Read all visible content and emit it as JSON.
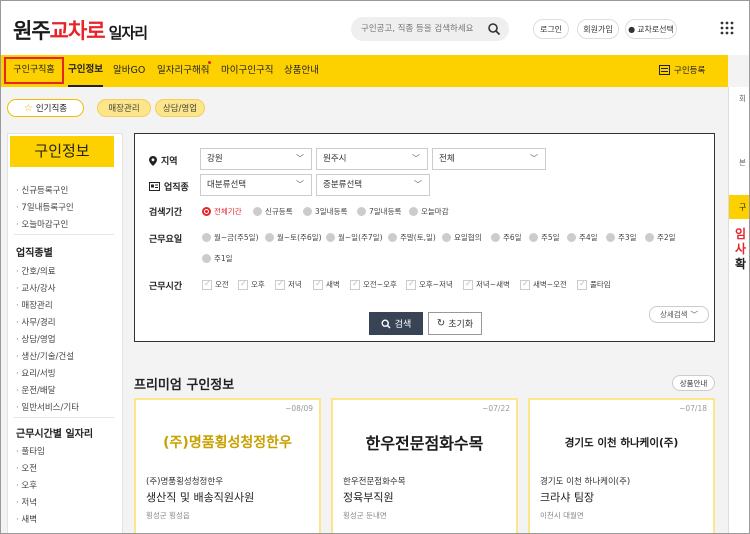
{
  "header": {
    "logo_part1": "원주",
    "logo_part2": "교차로",
    "logo_part3": "일자리",
    "search_placeholder": "구인공고, 직종 등을 검색하세요",
    "login": "로그인",
    "signup": "회원가입",
    "region_select": "교차로선택"
  },
  "nav": {
    "items": [
      {
        "label": "구인구직홈"
      },
      {
        "label": "구인정보"
      },
      {
        "label": "알바GO"
      },
      {
        "label": "일자리구해줘"
      },
      {
        "label": "마이구인구직"
      },
      {
        "label": "상품안내"
      }
    ],
    "register": "구인등록"
  },
  "chips": {
    "popular": "인기직종",
    "items": [
      "매장관리",
      "상담/영업"
    ]
  },
  "sidebar": {
    "title": "구인정보",
    "group1": [
      "신규등록구인",
      "7일내등록구인",
      "오늘마감구인"
    ],
    "head2": "업직종별",
    "group2": [
      "간호/의료",
      "교사/강사",
      "매장관리",
      "사무/경리",
      "상담/영업",
      "생산/기술/건설",
      "요리/서빙",
      "운전/배달",
      "일반서비스/기타"
    ],
    "head3": "근무시간별 일자리",
    "group3": [
      "풀타임",
      "오전",
      "오후",
      "저녁",
      "새벽"
    ]
  },
  "filter": {
    "region_label": "지역",
    "region_values": [
      "강원",
      "원주시",
      "전체"
    ],
    "industry_label": "업직종",
    "industry_values": [
      "대분류선택",
      "중분류선택"
    ],
    "period_label": "검색기간",
    "period_options": [
      "전체기간",
      "신규등록",
      "3일내등록",
      "7일내등록",
      "오늘마감"
    ],
    "period_selected": "전체기간",
    "days_label": "근무요일",
    "days_options": [
      "월~금(주5일)",
      "월~토(주6일)",
      "월~일(주7일)",
      "주말(토,일)",
      "요일협의",
      "주6일",
      "주5일",
      "주4일",
      "주3일",
      "주2일",
      "주1일"
    ],
    "hours_label": "근무시간",
    "hours_options": [
      "오전",
      "오후",
      "저녁",
      "새벽",
      "오전~오후",
      "오후~저녁",
      "저녁~새벽",
      "새벽~오전",
      "풀타임"
    ],
    "search_btn": "검색",
    "reset_btn": "초기화",
    "detail_btn": "상세검색"
  },
  "premium": {
    "title": "프리미엄 구인정보",
    "guide_btn": "상품안내",
    "cards": [
      {
        "date": "~08/09",
        "logo": "(주)명품횡성청정한우",
        "company": "(주)명품횡성청정한우",
        "job": "생산직 및 배송직원사원",
        "loc": "횡성군 횡성읍"
      },
      {
        "date": "~07/22",
        "logo": "한우전문점화수목",
        "company": "한우전문점화수목",
        "job": "정육부직원",
        "loc": "횡성군 둔내면"
      },
      {
        "date": "~07/18",
        "logo": "경기도 이천 하나케이(주)",
        "company": "경기도 이천 하나케이(주)",
        "job": "크라샤 팀장",
        "loc": "이천시 대월면"
      }
    ]
  },
  "right_panel": {
    "t1": "회",
    "t2": "본",
    "yellow": "구",
    "red1": "임",
    "red2": "사",
    "black": "확"
  },
  "colors": {
    "brand_yellow": "#fdd000",
    "brand_red": "#e8232a",
    "dark_button": "#384355"
  }
}
